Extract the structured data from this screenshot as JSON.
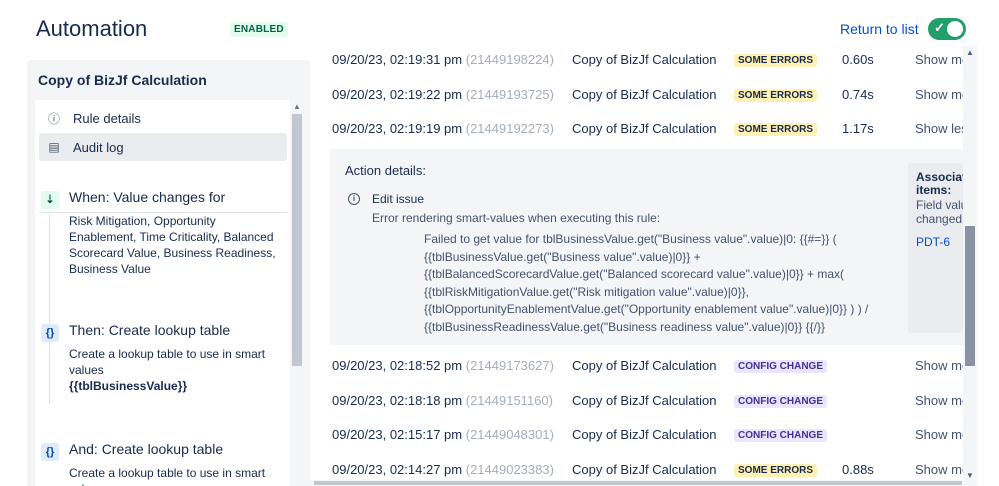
{
  "header": {
    "title": "Automation",
    "status_badge": "ENABLED",
    "return_link": "Return to list",
    "toggle_check": "✓"
  },
  "sidebar": {
    "rule_name": "Copy of BizJf Calculation",
    "nav": [
      {
        "label": "Rule details",
        "icon": "info-icon"
      },
      {
        "label": "Audit log",
        "icon": "document-icon"
      }
    ],
    "steps": [
      {
        "icon": "trigger-icon",
        "icon_glyph": "⇣",
        "title": "When: Value changes for",
        "desc": "Risk Mitigation, Opportunity Enablement, Time Criticality, Balanced Scorecard Value, Business Readiness, Business Value",
        "bold": ""
      },
      {
        "icon": "braces-icon",
        "icon_glyph": "{}",
        "title": "Then: Create lookup table",
        "desc": "Create a lookup table to use in smart values",
        "bold": "{{tblBusinessValue}}"
      },
      {
        "icon": "braces-icon",
        "icon_glyph": "{}",
        "title": "And: Create lookup table",
        "desc": "Create a lookup table to use in smart values",
        "bold": ""
      }
    ]
  },
  "log": {
    "rows_top": [
      {
        "date": "09/20/23, 02:19:31 pm",
        "id": "(21449198224)",
        "rule": "Copy of BizJf Calculation",
        "status": "SOME ERRORS",
        "duration": "0.60s",
        "action": "Show more"
      },
      {
        "date": "09/20/23, 02:19:22 pm",
        "id": "(21449193725)",
        "rule": "Copy of BizJf Calculation",
        "status": "SOME ERRORS",
        "duration": "0.74s",
        "action": "Show more"
      },
      {
        "date": "09/20/23, 02:19:19 pm",
        "id": "(21449192273)",
        "rule": "Copy of BizJf Calculation",
        "status": "SOME ERRORS",
        "duration": "1.17s",
        "action": "Show less"
      }
    ],
    "detail": {
      "label": "Action details:",
      "action": "Edit issue",
      "error": "Error rendering smart-values when executing this rule:",
      "code_lines": [
        "Failed to get value for tblBusinessValue.get(\"Business value\".value)|0: {{#=}} (",
        "{{tblBusinessValue.get(\"Business value\".value)|0}} +",
        "{{tblBalancedScorecardValue.get(\"Balanced scorecard value\".value)|0}} + max(",
        "{{tblRiskMitigationValue.get(\"Risk mitigation value\".value)|0}},",
        "{{tblOpportunityEnablementValue.get(\"Opportunity enablement value\".value)|0}} ) ) /",
        "{{tblBusinessReadinessValue.get(\"Business readiness value\".value)|0}} {{/}}"
      ],
      "associated_title": "Associated items:",
      "associated_desc": "Field value changed",
      "associated_link": "PDT-6"
    },
    "rows_bottom": [
      {
        "date": "09/20/23, 02:18:52 pm",
        "id": "(21449173627)",
        "rule": "Copy of BizJf Calculation",
        "status": "CONFIG CHANGE",
        "duration": "",
        "action": "Show more"
      },
      {
        "date": "09/20/23, 02:18:18 pm",
        "id": "(21449151160)",
        "rule": "Copy of BizJf Calculation",
        "status": "CONFIG CHANGE",
        "duration": "",
        "action": "Show more"
      },
      {
        "date": "09/20/23, 02:15:17 pm",
        "id": "(21449048301)",
        "rule": "Copy of BizJf Calculation",
        "status": "CONFIG CHANGE",
        "duration": "",
        "action": "Show more"
      },
      {
        "date": "09/20/23, 02:14:27 pm",
        "id": "(21449023383)",
        "rule": "Copy of BizJf Calculation",
        "status": "SOME ERRORS",
        "duration": "0.88s",
        "action": "Show more"
      }
    ]
  },
  "colors": {
    "error_badge_bg": "#fff0b3",
    "config_badge_bg": "#eae6ff",
    "enabled_green": "#22a06b",
    "link_blue": "#0052cc"
  }
}
